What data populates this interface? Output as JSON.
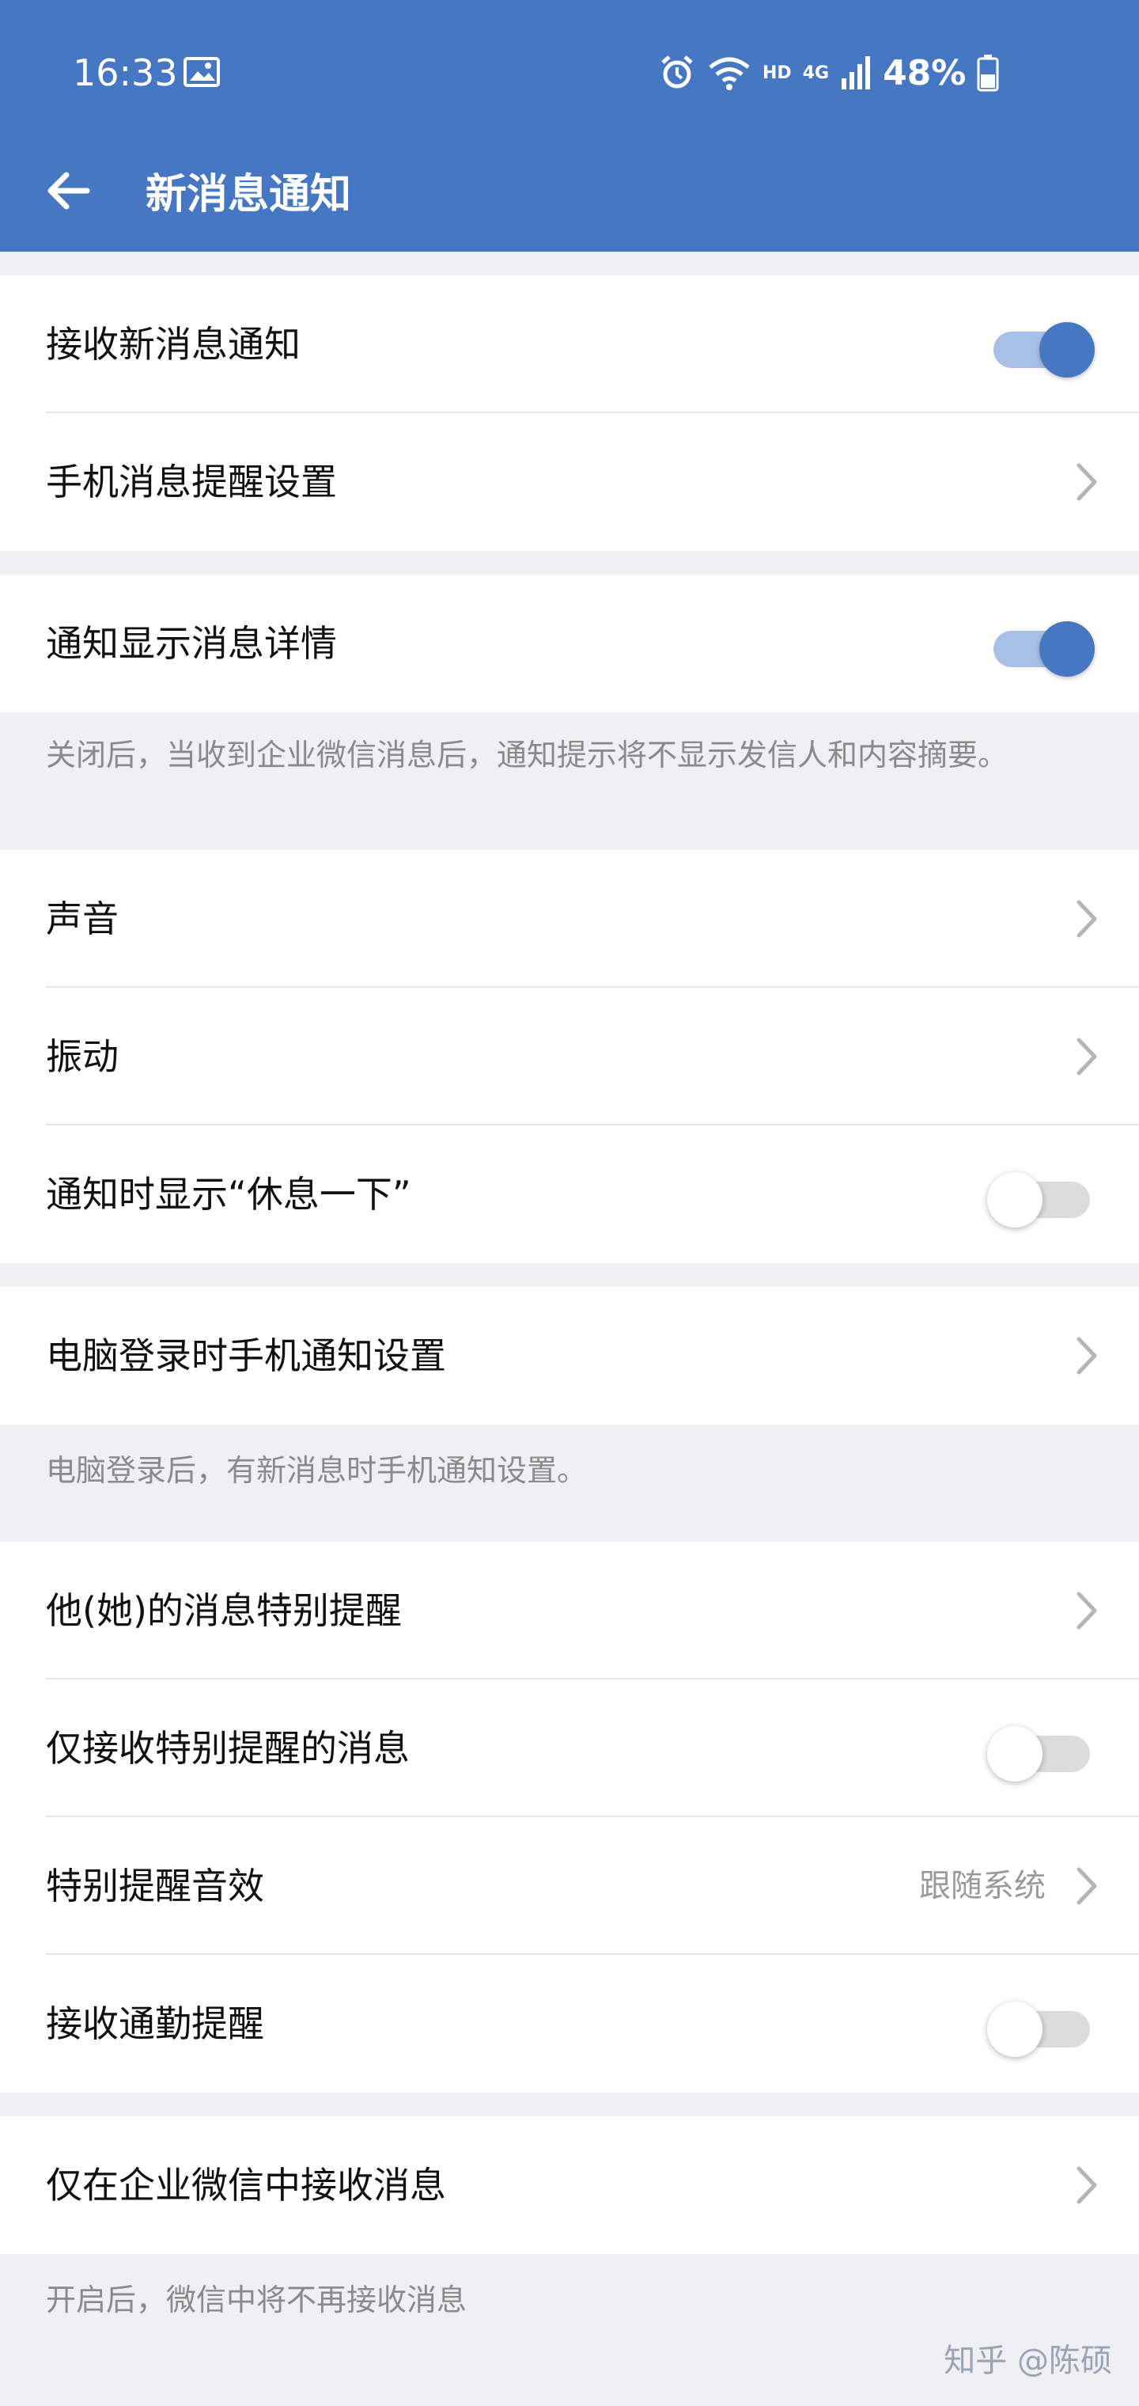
{
  "status_bar": {
    "time": "16:33",
    "network": "HD",
    "network_gen": "4G",
    "battery": "48%"
  },
  "app_bar": {
    "title": "新消息通知"
  },
  "groups": [
    {
      "rows": [
        {
          "label": "接收新消息通知",
          "control": "toggle",
          "on": true
        },
        {
          "label": "手机消息提醒设置",
          "control": "chevron"
        }
      ]
    },
    {
      "rows": [
        {
          "label": "通知显示消息详情",
          "control": "toggle",
          "on": true
        }
      ],
      "note": "关闭后，当收到企业微信消息后，通知提示将不显示发信人和内容摘要。"
    },
    {
      "rows": [
        {
          "label": "声音",
          "control": "chevron"
        },
        {
          "label": "振动",
          "control": "chevron"
        },
        {
          "label": "通知时显示“休息一下”",
          "control": "toggle",
          "on": false
        }
      ]
    },
    {
      "rows": [
        {
          "label": "电脑登录时手机通知设置",
          "control": "chevron"
        }
      ],
      "note": "电脑登录后，有新消息时手机通知设置。"
    },
    {
      "rows": [
        {
          "label": "他(她)的消息特别提醒",
          "control": "chevron"
        },
        {
          "label": "仅接收特别提醒的消息",
          "control": "toggle",
          "on": false
        },
        {
          "label": "特别提醒音效",
          "control": "chevron",
          "value": "跟随系统"
        },
        {
          "label": "接收通勤提醒",
          "control": "toggle",
          "on": false
        }
      ]
    },
    {
      "rows": [
        {
          "label": "仅在企业微信中接收消息",
          "control": "chevron"
        }
      ],
      "note": "开启后，微信中将不再接收消息"
    }
  ],
  "watermark": "知乎 @陈硕",
  "colors": {
    "primary": "#4677c2",
    "background": "#efeff4",
    "toggle_track_on": "#a9c0e6"
  },
  "icons": [
    "back-arrow-icon",
    "gallery-icon",
    "alarm-icon",
    "wifi-icon",
    "signal-icon",
    "battery-icon",
    "chevron-right-icon"
  ]
}
